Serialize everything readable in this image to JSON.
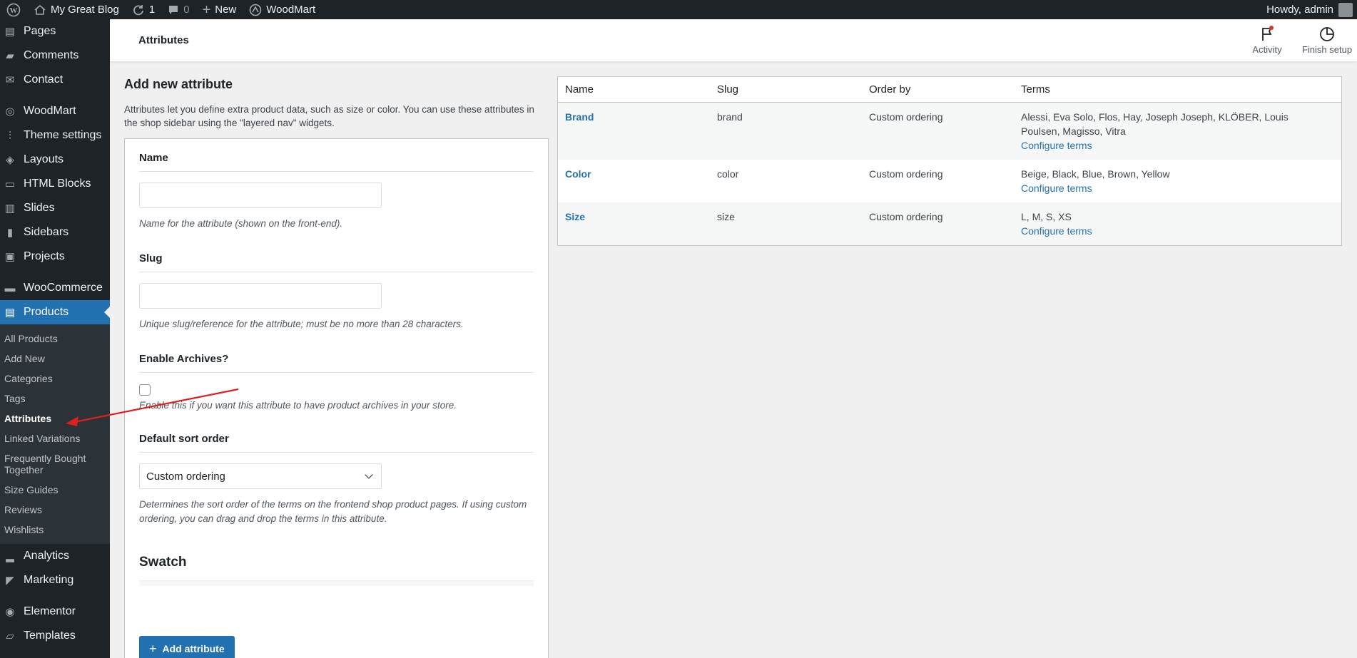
{
  "adminbar": {
    "site_name": "My Great Blog",
    "updates_count": "1",
    "comments_count": "0",
    "new_label": "New",
    "woodmart_label": "WoodMart",
    "howdy": "Howdy, admin"
  },
  "sidebar": {
    "items_top": [
      {
        "label": "Pages",
        "icon": "pages-icon"
      },
      {
        "label": "Comments",
        "icon": "comments-icon"
      },
      {
        "label": "Contact",
        "icon": "mail-icon"
      }
    ],
    "items_mid": [
      {
        "label": "WoodMart",
        "icon": "woodmart-icon"
      },
      {
        "label": "Theme settings",
        "icon": "sliders-icon"
      },
      {
        "label": "Layouts",
        "icon": "layers-icon"
      },
      {
        "label": "HTML Blocks",
        "icon": "code-icon"
      },
      {
        "label": "Slides",
        "icon": "slides-icon"
      },
      {
        "label": "Sidebars",
        "icon": "sidebar-icon"
      },
      {
        "label": "Projects",
        "icon": "briefcase-icon"
      }
    ],
    "woocommerce": "WooCommerce",
    "products": "Products",
    "submenu": [
      "All Products",
      "Add New",
      "Categories",
      "Tags",
      "Attributes",
      "Linked Variations",
      "Frequently Bought Together",
      "Size Guides",
      "Reviews",
      "Wishlists"
    ],
    "items_bottom": [
      {
        "label": "Analytics",
        "icon": "bar-chart-icon"
      },
      {
        "label": "Marketing",
        "icon": "megaphone-icon"
      }
    ],
    "items_end": [
      {
        "label": "Elementor",
        "icon": "elementor-icon"
      },
      {
        "label": "Templates",
        "icon": "folder-icon"
      }
    ]
  },
  "header": {
    "title": "Attributes",
    "activity": "Activity",
    "finish_setup": "Finish setup"
  },
  "form": {
    "title": "Add new attribute",
    "description": "Attributes let you define extra product data, such as size or color. You can use these attributes in the shop sidebar using the \"layered nav\" widgets.",
    "name_label": "Name",
    "name_help": "Name for the attribute (shown on the front-end).",
    "slug_label": "Slug",
    "slug_help": "Unique slug/reference for the attribute; must be no more than 28 characters.",
    "archives_label": "Enable Archives?",
    "archives_help": "Enable this if you want this attribute to have product archives in your store.",
    "sort_label": "Default sort order",
    "sort_value": "Custom ordering",
    "sort_help": "Determines the sort order of the terms on the frontend shop product pages. If using custom ordering, you can drag and drop the terms in this attribute.",
    "swatch_title": "Swatch",
    "add_button": "Add attribute"
  },
  "table": {
    "headers": [
      "Name",
      "Slug",
      "Order by",
      "Terms"
    ],
    "configure_label": "Configure terms",
    "rows": [
      {
        "name": "Brand",
        "slug": "brand",
        "order": "Custom ordering",
        "terms": "Alessi, Eva Solo, Flos, Hay, Joseph Joseph, KLÖBER, Louis Poulsen, Magisso, Vitra"
      },
      {
        "name": "Color",
        "slug": "color",
        "order": "Custom ordering",
        "terms": "Beige, Black, Blue, Brown, Yellow"
      },
      {
        "name": "Size",
        "slug": "size",
        "order": "Custom ordering",
        "terms": "L, M, S, XS"
      }
    ]
  },
  "colors": {
    "accent": "#2271b1",
    "admin_dark": "#1d2327",
    "annotation_arrow": "#e0201f"
  }
}
